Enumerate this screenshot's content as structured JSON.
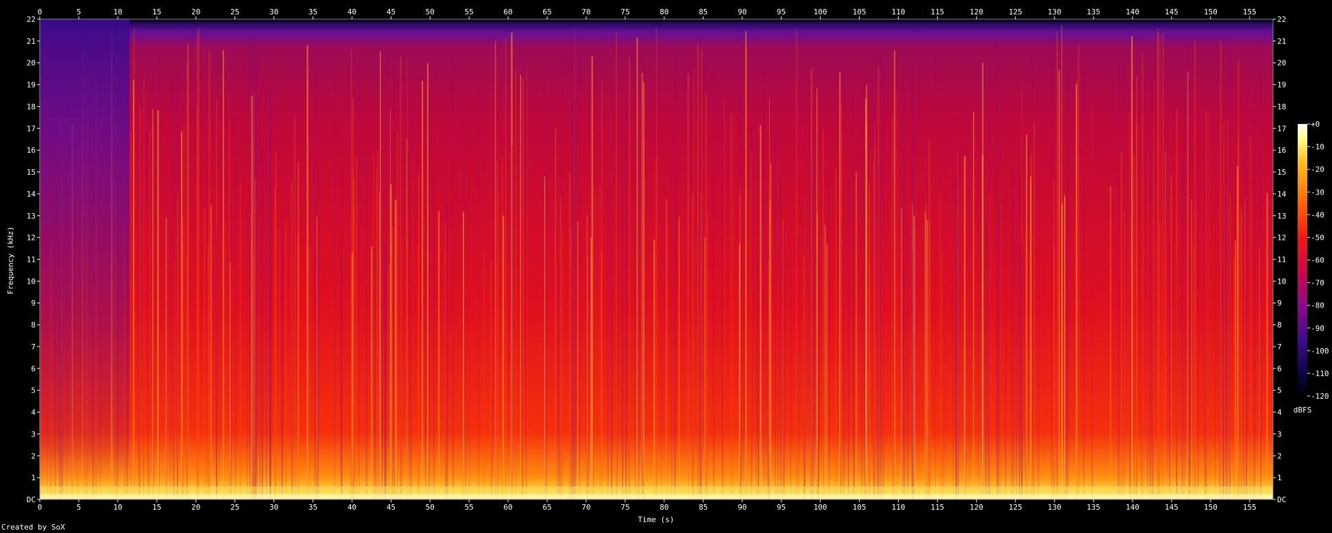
{
  "chart_data": {
    "type": "heatmap",
    "subtype": "spectrogram",
    "xlabel": "Time (s)",
    "ylabel": "Frequency (kHz)",
    "xlim": [
      0,
      158
    ],
    "ylim": [
      0,
      22
    ],
    "x_ticks": [
      "0",
      "5",
      "10",
      "15",
      "20",
      "25",
      "30",
      "35",
      "40",
      "45",
      "50",
      "55",
      "60",
      "65",
      "70",
      "75",
      "80",
      "85",
      "90",
      "95",
      "100",
      "105",
      "110",
      "115",
      "120",
      "125",
      "130",
      "135",
      "140",
      "145",
      "150",
      "155"
    ],
    "y_ticks": [
      "DC",
      "1",
      "2",
      "3",
      "4",
      "5",
      "6",
      "7",
      "8",
      "9",
      "10",
      "11",
      "12",
      "13",
      "14",
      "15",
      "16",
      "17",
      "18",
      "19",
      "20",
      "21",
      "22"
    ],
    "colorbar": {
      "label": "dBFS",
      "range": [
        -120,
        0
      ],
      "ticks": [
        "+0",
        "-10",
        "-20",
        "-30",
        "-40",
        "-50",
        "-60",
        "-70",
        "-80",
        "-90",
        "-100",
        "-110",
        "-120"
      ]
    },
    "grid": false,
    "energy_profile": {
      "description_levels_dbfs_by_frequency_khz": [
        {
          "freq": 0.3,
          "level": -15
        },
        {
          "freq": 1,
          "level": -25
        },
        {
          "freq": 3,
          "level": -35
        },
        {
          "freq": 6,
          "level": -45
        },
        {
          "freq": 12,
          "level": -55
        },
        {
          "freq": 20,
          "level": -65
        },
        {
          "freq": 21.5,
          "level": -95
        }
      ],
      "quiet_intro_end_s": 11.5
    }
  },
  "credit_text": "Created by SoX"
}
